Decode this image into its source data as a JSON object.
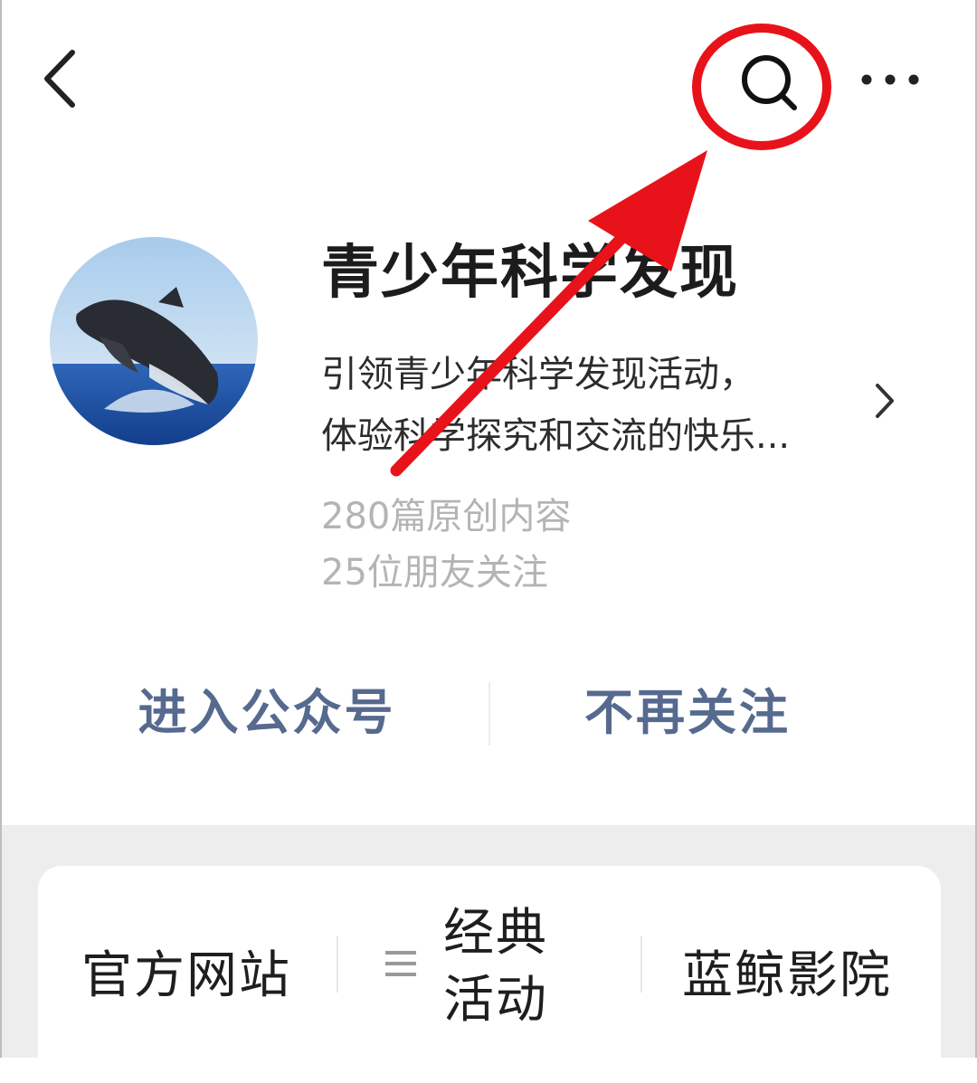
{
  "header": {
    "back_icon": "chevron-left-icon",
    "search_icon": "search-icon",
    "more_icon": "more-dots-icon"
  },
  "profile": {
    "name": "青少年科学发现",
    "description_line1": "引领青少年科学发现活动，",
    "description_line2": "体验科学探究和交流的快乐...",
    "original_count": "280篇原创内容",
    "friends_following": "25位朋友关注",
    "avatar": "whale-breaching-avatar"
  },
  "actions": {
    "enter_label": "进入公众号",
    "unfollow_label": "不再关注"
  },
  "menu": {
    "official_site": "官方网站",
    "classic_events": "经典活动",
    "cinema": "蓝鲸影院"
  },
  "annotation": {
    "color": "#e8131a",
    "type": "circle-and-arrow"
  }
}
